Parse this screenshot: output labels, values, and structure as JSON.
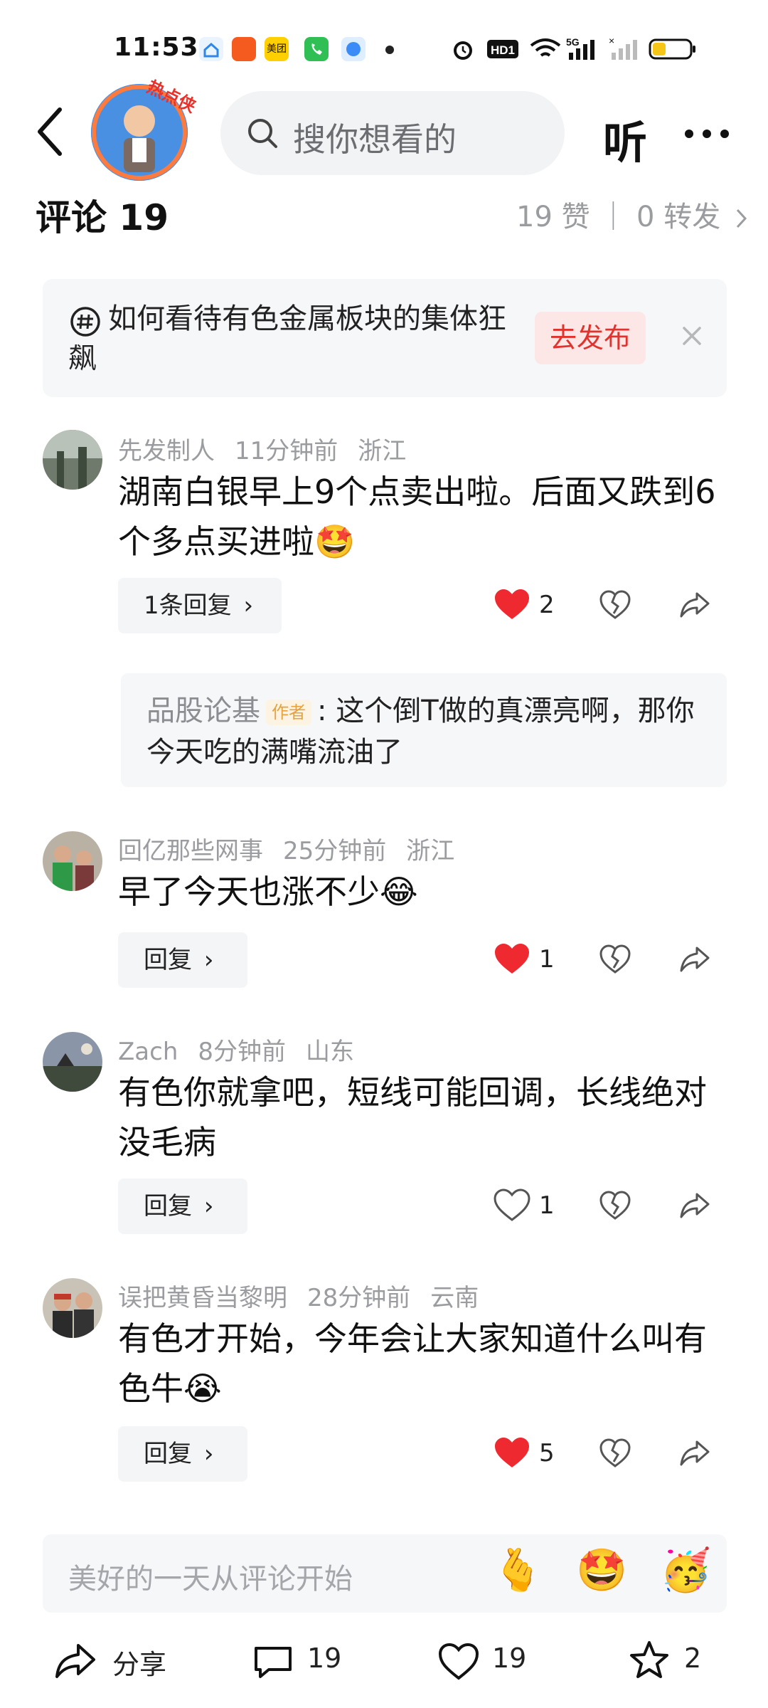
{
  "status_bar": {
    "time": "11:53",
    "app_icons": [
      "home-app-icon",
      "alipay-app-icon",
      "meituan-app-icon",
      "phone-app-icon",
      "browser-app-icon"
    ],
    "right_icons": [
      "alarm-icon",
      "hd-icon",
      "wifi-icon",
      "5g-signal-icon",
      "signal-icon",
      "battery-icon"
    ]
  },
  "header": {
    "hot_tag": "热点侠",
    "search_placeholder": "搜你想看的",
    "listen_label": "听"
  },
  "comments_header": {
    "title": "评论 19",
    "summary": "19 赞 ｜ 0 转发"
  },
  "topic": {
    "text": "如何看待有色金属板块的集体狂飙",
    "button": "去发布"
  },
  "comments": [
    {
      "user": "先发制人",
      "time": "11分钟前",
      "location": "浙江",
      "text": "湖南白银早上9个点卖出啦。后面又跌到6个多点买进啦🤩",
      "reply_label": "1条回复",
      "likes": "2",
      "liked": true,
      "nested_reply": {
        "user": "品股论基",
        "tag": "作者",
        "text": ": 这个倒T做的真漂亮啊，那你今天吃的满嘴流油了"
      }
    },
    {
      "user": "回亿那些网事",
      "time": "25分钟前",
      "location": "浙江",
      "text": "早了今天也涨不少😂",
      "reply_label": "回复",
      "likes": "1",
      "liked": true
    },
    {
      "user": "Zach",
      "time": "8分钟前",
      "location": "山东",
      "text": "有色你就拿吧，短线可能回调，长线绝对没毛病",
      "reply_label": "回复",
      "likes": "1",
      "liked": false
    },
    {
      "user": "误把黄昏当黎明",
      "time": "28分钟前",
      "location": "云南",
      "text": "有色才开始，今年会让大家知道什么叫有色牛😭",
      "reply_label": "回复",
      "likes": "5",
      "liked": true
    }
  ],
  "input": {
    "placeholder": "美好的一天从评论开始",
    "emojis": [
      "🫰",
      "🤩",
      "🥳"
    ]
  },
  "bottom_bar": {
    "share_label": "分享",
    "comment_count": "19",
    "like_count": "19",
    "favorite_count": "2"
  },
  "colors": {
    "accent_red": "#e8312a",
    "text_gray": "#9a9ca0",
    "background": "#ffffff"
  }
}
